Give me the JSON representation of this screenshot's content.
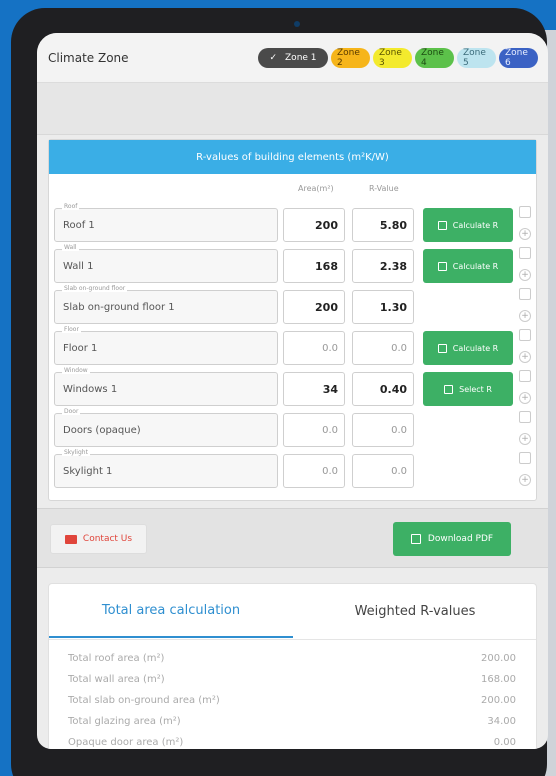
{
  "header": {
    "title": "Climate Zone",
    "zones": [
      {
        "label": "Zone 1",
        "bg": "#4a4a4a",
        "fg": "#ffffff",
        "selected": true
      },
      {
        "label": "Zone 2",
        "bg": "#f6b51a",
        "fg": "#5a3b00",
        "selected": false
      },
      {
        "label": "Zone 3",
        "bg": "#f3ea2d",
        "fg": "#5a5500",
        "selected": false
      },
      {
        "label": "Zone 4",
        "bg": "#5cc14a",
        "fg": "#1d4d12",
        "selected": false
      },
      {
        "label": "Zone 5",
        "bg": "#bde4ef",
        "fg": "#3b6b7a",
        "selected": false
      },
      {
        "label": "Zone 6",
        "bg": "#3b62c4",
        "fg": "#e8eeff",
        "selected": false
      }
    ],
    "check_glyph": "✓"
  },
  "card": {
    "title": "R-values of building elements (m²K/W)",
    "col_area": "Area(m²)",
    "col_rvalue": "R-Value",
    "rows": [
      {
        "legend": "Roof",
        "name": "Roof 1",
        "area": "200",
        "rvalue": "5.80",
        "button": "Calculate R",
        "filled": true
      },
      {
        "legend": "Wall",
        "name": "Wall 1",
        "area": "168",
        "rvalue": "2.38",
        "button": "Calculate R",
        "filled": true
      },
      {
        "legend": "Slab on-ground floor",
        "name": "Slab on-ground floor 1",
        "area": "200",
        "rvalue": "1.30",
        "button": "",
        "filled": true
      },
      {
        "legend": "Floor",
        "name": "Floor 1",
        "area": "0.0",
        "rvalue": "0.0",
        "button": "Calculate R",
        "filled": false
      },
      {
        "legend": "Window",
        "name": "Windows 1",
        "area": "34",
        "rvalue": "0.40",
        "button": "Select R",
        "filled": true
      },
      {
        "legend": "Door",
        "name": "Doors (opaque)",
        "area": "0.0",
        "rvalue": "0.0",
        "button": "",
        "filled": false
      },
      {
        "legend": "Skylight",
        "name": "Skylight 1",
        "area": "0.0",
        "rvalue": "0.0",
        "button": "",
        "filled": false
      }
    ],
    "plus_glyph": "+"
  },
  "actions": {
    "contact_label": "Contact Us",
    "pdf_label": "Download PDF"
  },
  "summary": {
    "tabs": [
      "Total area calculation",
      "Weighted R-values"
    ],
    "rows": [
      {
        "label": "Total roof area (m²)",
        "value": "200.00"
      },
      {
        "label": "Total wall area (m²)",
        "value": "168.00"
      },
      {
        "label": "Total slab on-ground area (m²)",
        "value": "200.00"
      },
      {
        "label": "Total glazing area (m²)",
        "value": "34.00"
      },
      {
        "label": "Opaque door area (m²)",
        "value": "0.00"
      }
    ]
  },
  "colors": {
    "accent_blue": "#3aaee6",
    "button_green": "#3db065",
    "contact_red": "#e0453b",
    "tab_blue": "#2f8fd0"
  }
}
